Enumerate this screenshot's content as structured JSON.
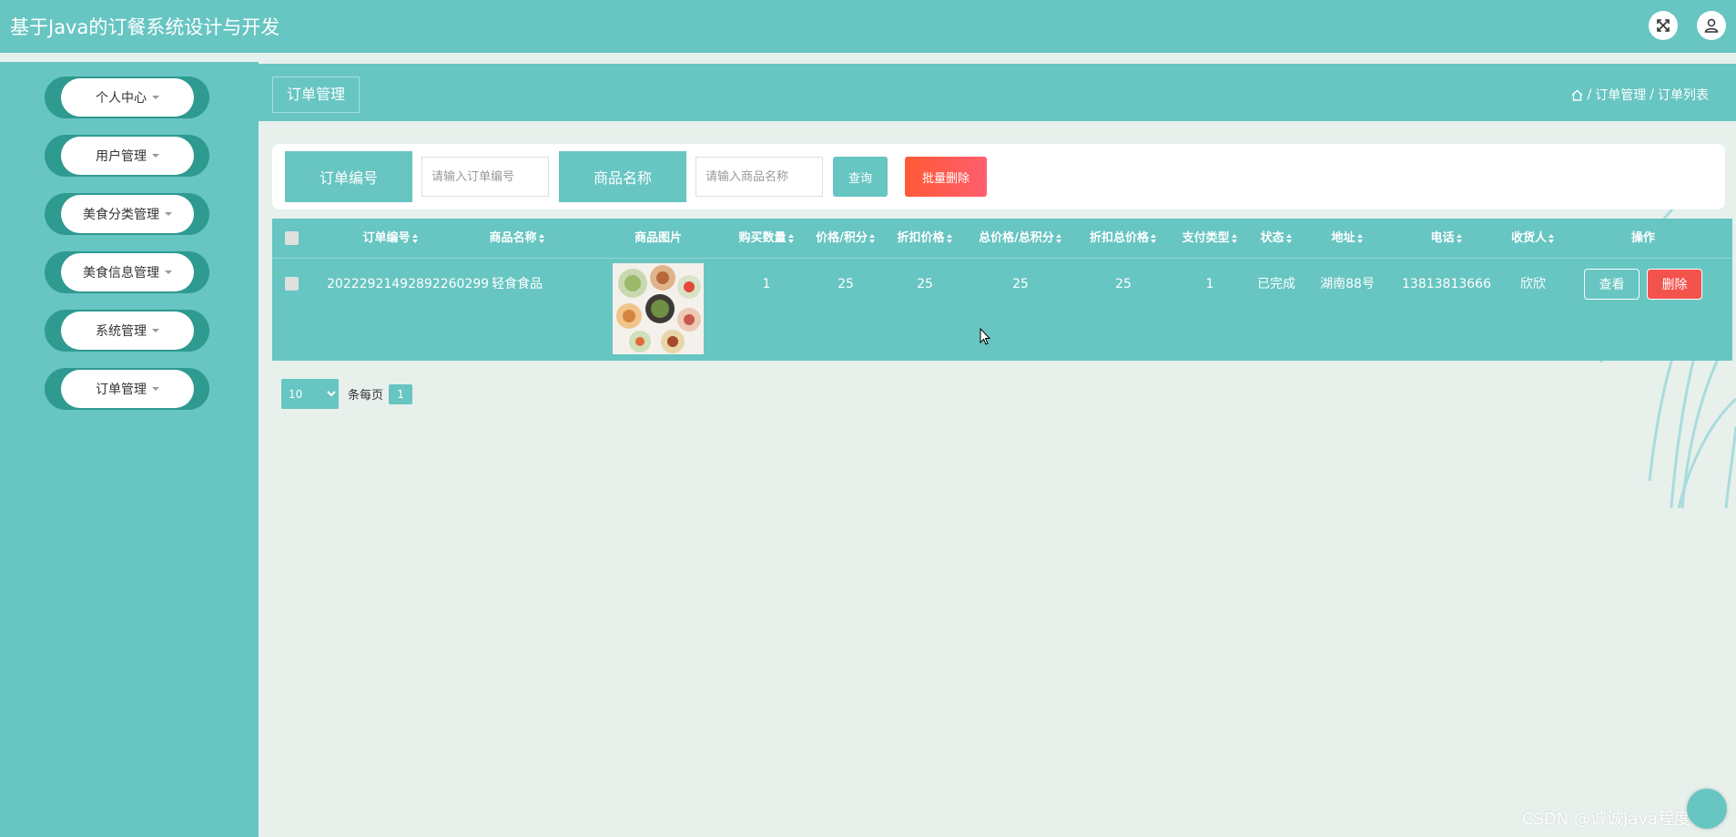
{
  "header": {
    "title": "基于Java的订餐系统设计与开发",
    "fullscreen_icon": "expand-icon",
    "user_icon": "user-icon"
  },
  "sidebar": {
    "items": [
      {
        "label": "个人中心"
      },
      {
        "label": "用户管理"
      },
      {
        "label": "美食分类管理"
      },
      {
        "label": "美食信息管理"
      },
      {
        "label": "系统管理"
      },
      {
        "label": "订单管理"
      }
    ]
  },
  "page": {
    "title": "订单管理",
    "breadcrumb": [
      "订单管理",
      "订单列表"
    ],
    "breadcrumb_sep": "/"
  },
  "search": {
    "order_no_label": "订单编号",
    "order_no_placeholder": "请输入订单编号",
    "product_label": "商品名称",
    "product_placeholder": "请输入商品名称",
    "query_label": "查询",
    "batch_delete_label": "批量删除"
  },
  "table": {
    "headers": {
      "order_no": "订单编号",
      "product": "商品名称",
      "image": "商品图片",
      "qty": "购买数量",
      "price": "价格/积分",
      "discount_price": "折扣价格",
      "total": "总价格/总积分",
      "discount_total": "折扣总价格",
      "pay_type": "支付类型",
      "status": "状态",
      "address": "地址",
      "phone": "电话",
      "receiver": "收货人",
      "actions": "操作"
    },
    "rows": [
      {
        "order_no": "20222921492892260299",
        "product": "轻食食品",
        "qty": "1",
        "price": "25",
        "discount_price": "25",
        "total": "25",
        "discount_total": "25",
        "pay_type": "1",
        "status": "已完成",
        "address": "湖南88号",
        "phone": "13813813666",
        "receiver": "欣欣",
        "view_label": "查看",
        "delete_label": "删除"
      }
    ]
  },
  "pagination": {
    "page_size": "10",
    "per_page_label": "条每页",
    "current_page": "1"
  },
  "watermark": "CSDN @诚诚Java程度源码",
  "colors": {
    "primary": "#67c5c2",
    "danger": "#f4524d",
    "sidebar_pill_edge": "#2e9a90"
  }
}
